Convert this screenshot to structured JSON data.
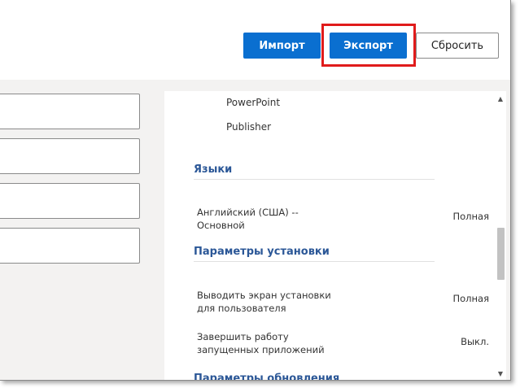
{
  "toolbar": {
    "import_label": "Импорт",
    "export_label": "Экспорт",
    "reset_label": "Сбросить"
  },
  "panel": {
    "apps": [
      "PowerPoint",
      "Publisher"
    ],
    "languages_title": "Языки",
    "languages": [
      {
        "label": "Английский (США) --Основной",
        "value": "Полная"
      }
    ],
    "install_title": "Параметры установки",
    "install_options": [
      {
        "label": "Выводить экран установки для пользователя",
        "value": "Полная"
      },
      {
        "label": "Завершить работу запущенных приложений",
        "value": "Выкл."
      }
    ],
    "next_title": "Параметры обновления"
  },
  "colors": {
    "primary_button": "#0a6fd0",
    "highlight": "#e01b1b",
    "section_title": "#2b5797",
    "background": "#f3f2f1"
  },
  "icons": {
    "scroll_up": "▲",
    "scroll_down": "▼"
  }
}
